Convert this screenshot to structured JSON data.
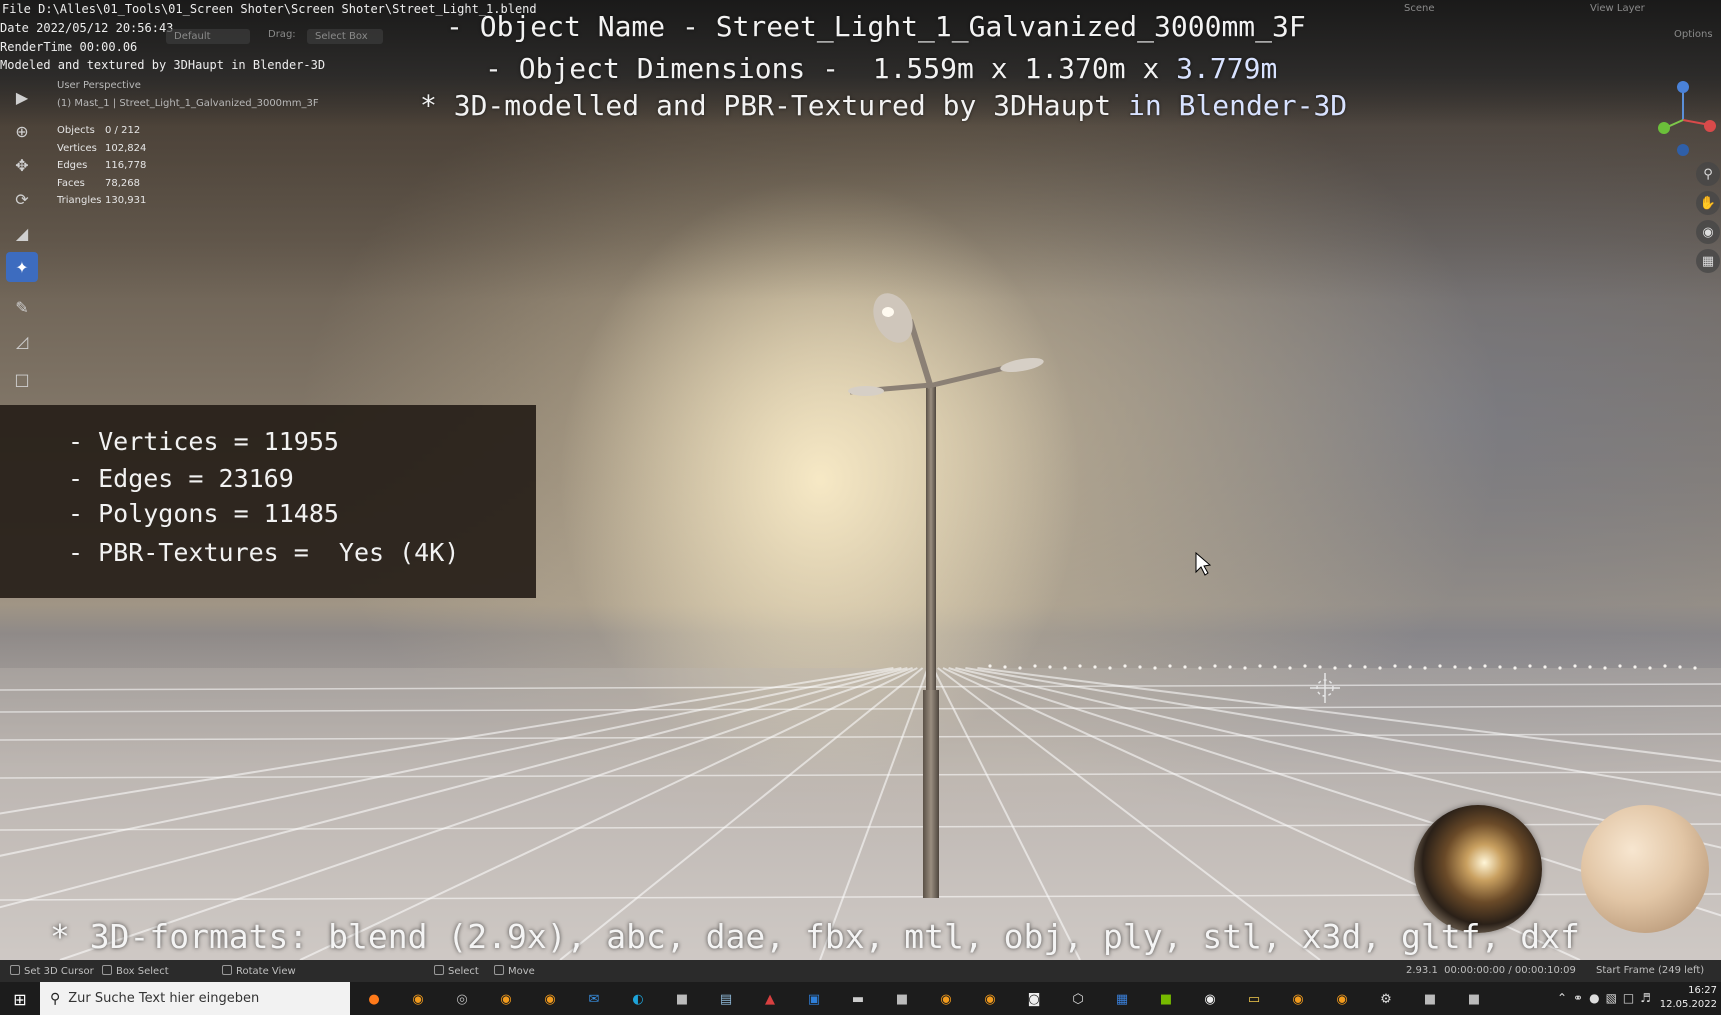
{
  "header": {
    "file_path": "File D:\\Alles\\01_Tools\\01_Screen Shoter\\Screen Shoter\\Street_Light_1.blend",
    "date": "Date 2022/05/12 20:56:43",
    "render_time": "RenderTime 00:00.06",
    "modeled_by": "Modeled and textured by 3DHaupt in Blender-3D",
    "orientation_default": "Default",
    "drag_label": "Drag:",
    "drag_value": "Select Box",
    "scene_label": "Scene",
    "view_layer_label": "View Layer",
    "options_label": "Options"
  },
  "viewport": {
    "perspective": "User Perspective",
    "collection_path": "(1) Mast_1 | Street_Light_1_Galvanized_3000mm_3F"
  },
  "overlay": {
    "title_name": "- Object Name - Street_Light_1_Galvanized_3000mm_3F",
    "dims_prefix": "- Object Dimensions -  1.559m x 1.370m x ",
    "dims_last": "3.779m",
    "modeled_prefix": "* 3D-modelled and PBR-Textured by 3DHaupt ",
    "modeled_suffix": "in Blender-3D",
    "formats": "* 3D-formats: blend (2.9x), abc, dae, fbx, mtl, obj, ply, stl, x3d, gltf, dxf"
  },
  "stats": [
    {
      "k": "Objects",
      "v": "0 / 212"
    },
    {
      "k": "Vertices",
      "v": "102,824"
    },
    {
      "k": "Edges",
      "v": "116,778"
    },
    {
      "k": "Faces",
      "v": "78,268"
    },
    {
      "k": "Triangles",
      "v": "130,931"
    }
  ],
  "info_panel": {
    "vertices": "- Vertices = 11955",
    "edges": "- Edges = 23169",
    "polygons": "- Polygons = 11485",
    "textures": "- PBR-Textures =  Yes (4K)"
  },
  "status_bar": {
    "set_cursor": "Set 3D Cursor",
    "box_select": "Box Select",
    "rotate_view": "Rotate View",
    "select": "Select",
    "move": "Move",
    "version": "2.93.1  00:00:00:00 / 00:00:10:09",
    "start_frame": "Start Frame (249 left)"
  },
  "taskbar": {
    "search_placeholder": "Zur Suche Text hier eingeben",
    "time": "16:27",
    "date": "12.05.2022"
  },
  "colors": {
    "accent_blue": "#3d6cbf",
    "panel_bg": "#261e18",
    "status_bg": "#2b2b2b",
    "taskbar_bg": "#1c1c1c"
  },
  "icons": {
    "toolbar": [
      "select-box-icon",
      "cursor-icon",
      "move-icon",
      "rotate-icon",
      "scale-icon",
      "transform-icon",
      "annotate-icon",
      "measure-icon",
      "add-cube-icon"
    ],
    "taskbar": [
      "firefox-icon",
      "blender-icon",
      "chrome-icon",
      "blender-icon",
      "blender-icon",
      "mail-icon",
      "edge-icon",
      "app-icon",
      "notes-icon",
      "paint-icon",
      "store-icon",
      "terminal-icon",
      "app-icon",
      "blender-icon",
      "blender-icon",
      "panda-icon",
      "cube-icon",
      "calendar-icon",
      "nvidia-icon",
      "obs-icon",
      "explorer-icon",
      "blender-icon",
      "blender-icon",
      "settings-icon",
      "app-icon",
      "app-icon"
    ]
  }
}
